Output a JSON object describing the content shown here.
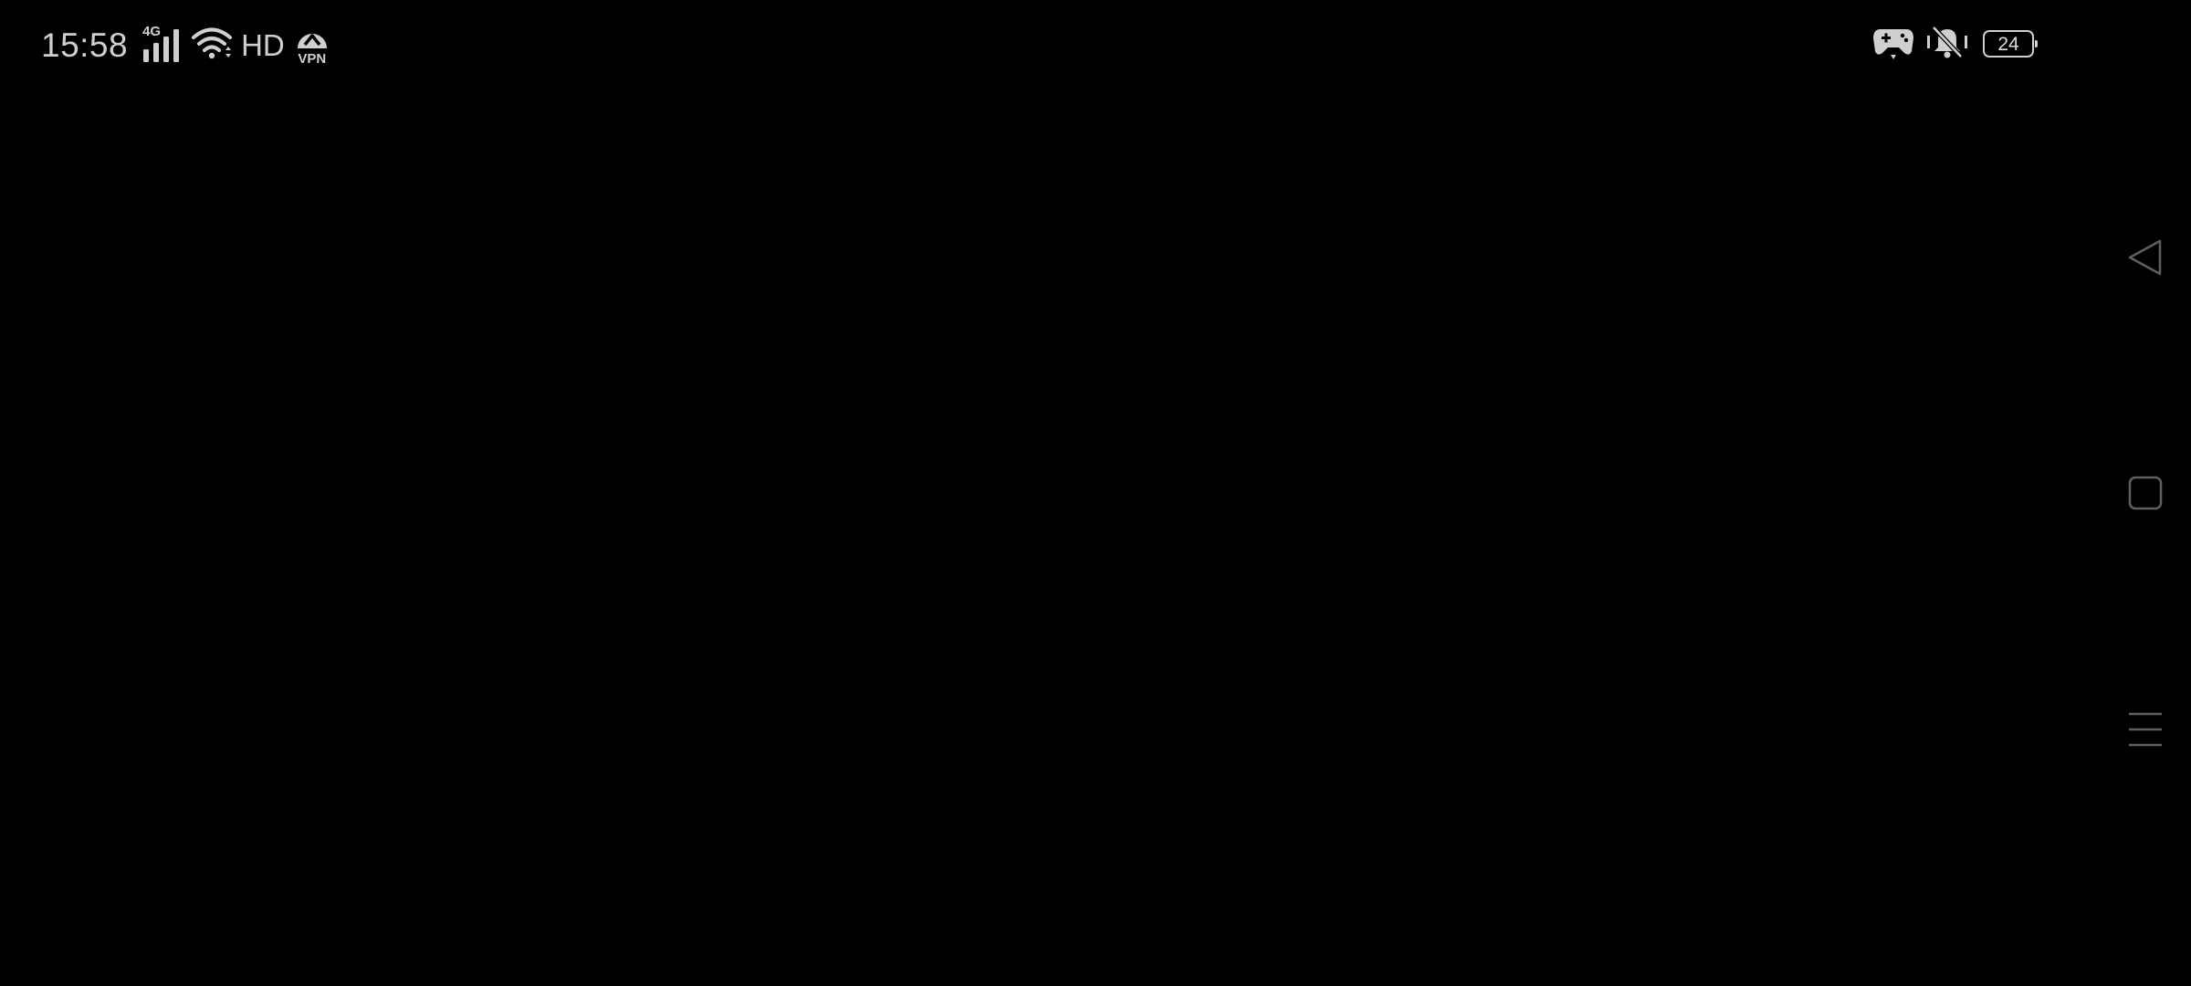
{
  "status_bar": {
    "time": "15:58",
    "network_type": "4G",
    "hd": "HD",
    "vpn": "VPN",
    "battery": "24",
    "icons": [
      "signal-icon",
      "wifi-icon",
      "vpn-icon",
      "game-mode-icon",
      "mute-vibrate-icon",
      "battery-icon"
    ]
  },
  "navigation": {
    "buttons": [
      "back-icon",
      "home-icon",
      "recents-icon"
    ]
  },
  "colors": {
    "background": "#000000",
    "status_foreground": "#cfcfcf",
    "nav_foreground": "#5f5f5f"
  }
}
